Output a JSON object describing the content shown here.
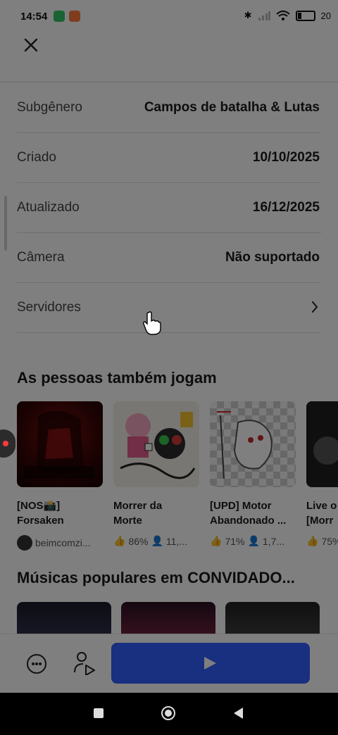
{
  "status_bar": {
    "time": "14:54",
    "battery": "20"
  },
  "info_rows": [
    {
      "label": "Subgênero",
      "value": "Campos de batalha & Lutas"
    },
    {
      "label": "Criado",
      "value": "10/10/2025"
    },
    {
      "label": "Atualizado",
      "value": "16/12/2025"
    },
    {
      "label": "Câmera",
      "value": "Não suportado"
    },
    {
      "label": "Servidores",
      "value": ""
    }
  ],
  "section_also_play": {
    "title": "As pessoas também jogam",
    "games": [
      {
        "title1": "[NOS📸]",
        "title2": "Forsaken",
        "creator": "beimcomzi...",
        "rating": "",
        "players": ""
      },
      {
        "title1": "Morrer da",
        "title2": "Morte",
        "creator": "",
        "rating": "86%",
        "players": "11,..."
      },
      {
        "title1": "[UPD] Motor",
        "title2": "Abandonado ...",
        "creator": "",
        "rating": "71%",
        "players": "1,7..."
      },
      {
        "title1": "Live o",
        "title2": "[Morr",
        "creator": "",
        "rating": "75%",
        "players": ""
      }
    ]
  },
  "section_music": {
    "title": "Músicas populares em CONVIDADO..."
  },
  "colors": {
    "play_button": "#335fff",
    "overlay": "rgba(0,0,0,0.5)"
  }
}
